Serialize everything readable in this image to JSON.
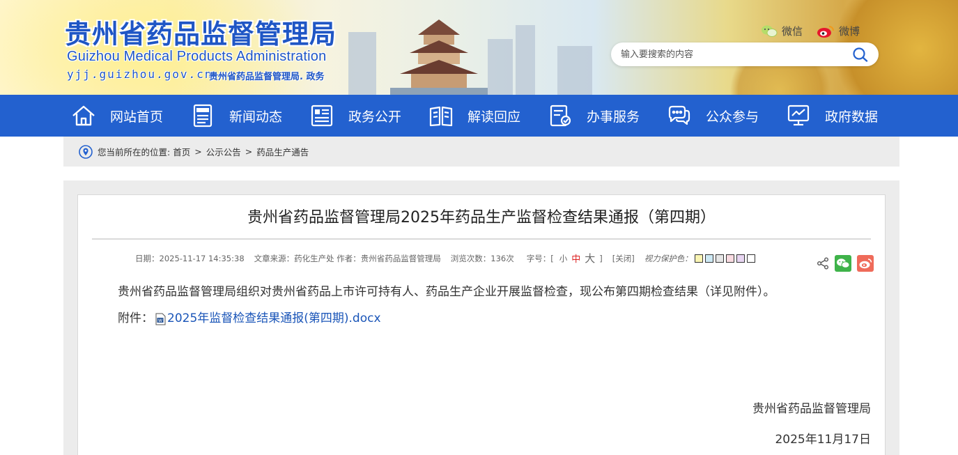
{
  "header": {
    "logo_cn": "贵州省药品监督管理局",
    "logo_en": "Guizhou Medical Products Administration",
    "url": "yjj.guizhou.gov.cn",
    "tagline": "贵州省药品监督管理局. 政务",
    "wechat_label": "微信",
    "weibo_label": "微博",
    "search_placeholder": "输入要搜索的内容"
  },
  "nav": {
    "items": [
      {
        "label": "网站首页",
        "icon": "home-icon"
      },
      {
        "label": "新闻动态",
        "icon": "news-icon"
      },
      {
        "label": "政务公开",
        "icon": "document-list-icon"
      },
      {
        "label": "解读回应",
        "icon": "open-book-icon"
      },
      {
        "label": "办事服务",
        "icon": "service-form-icon"
      },
      {
        "label": "公众参与",
        "icon": "chat-bubble-icon"
      },
      {
        "label": "政府数据",
        "icon": "data-monitor-icon"
      }
    ]
  },
  "breadcrumb": {
    "prefix": "您当前所在的位置:",
    "items": [
      "首页",
      "公示公告",
      "药品生产通告"
    ],
    "separator": ">"
  },
  "article": {
    "title": "贵州省药品监督管理局2025年药品生产监督检查结果通报（第四期）",
    "meta": {
      "date": "日期：2025-11-17 14:35:38",
      "source": "文章来源：药化生产处 作者：贵州省药品监督管理局",
      "views": "浏览次数：136次",
      "font_size_label": "字号：[",
      "font_small": "小",
      "font_medium": "中",
      "font_large": "大",
      "font_close_bracket": "]",
      "close": "[关闭]",
      "vision_label": "视力保护色："
    },
    "vision_colors": [
      "#faf5b4",
      "#cde9f4",
      "#e6e6e6",
      "#f9dbe1",
      "#e8d6f2",
      "#ffffff"
    ],
    "body": "贵州省药品监督管理局组织对贵州省药品上市许可持有人、药品生产企业开展监督检查，现公布第四期检查结果（详见附件）。",
    "attachment_label": "附件：",
    "attachment_name": "2025年监督检查结果通报(第四期).docx",
    "signature_org": "贵州省药品监督管理局",
    "signature_date": "2025年11月17日"
  },
  "colors": {
    "brand_blue": "#2361cf",
    "logo_blue": "#1f56c5",
    "link_blue": "#1a55b8",
    "wechat_green": "#3fb34a",
    "weibo_red": "#ef6b5a"
  }
}
